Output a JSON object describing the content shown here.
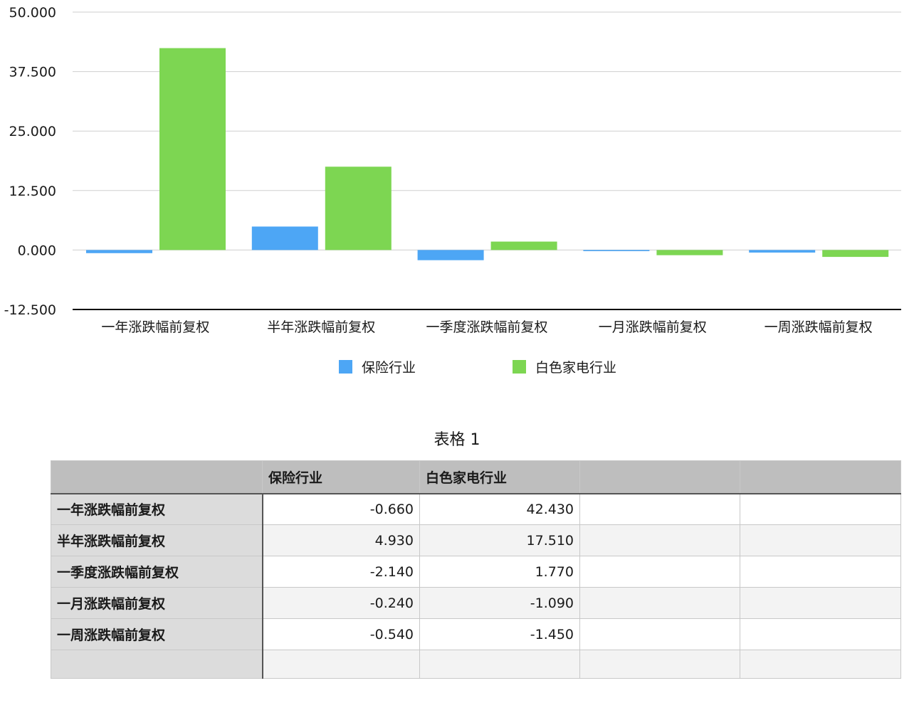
{
  "chart_data": {
    "type": "bar",
    "categories": [
      "一年涨跌幅前复权",
      "半年涨跌幅前复权",
      "一季度涨跌幅前复权",
      "一月涨跌幅前复权",
      "一周涨跌幅前复权"
    ],
    "series": [
      {
        "name": "保险行业",
        "values": [
          -0.66,
          4.93,
          -2.14,
          -0.24,
          -0.54
        ],
        "color": "#4da6f5"
      },
      {
        "name": "白色家电行业",
        "values": [
          42.43,
          17.51,
          1.77,
          -1.09,
          -1.45
        ],
        "color": "#7dd652"
      }
    ],
    "ylim": [
      -12.5,
      50
    ],
    "yticks": [
      "50.000",
      "37.500",
      "25.000",
      "12.500",
      "0.000",
      "-12.500"
    ],
    "grid": true,
    "legend": "bottom",
    "title": "",
    "xlabel": "",
    "ylabel": ""
  },
  "table": {
    "title": "表格 1",
    "headers": [
      "",
      "保险行业",
      "白色家电行业",
      "",
      ""
    ],
    "rows": [
      {
        "label": "一年涨跌幅前复权",
        "values": [
          "-0.660",
          "42.430",
          "",
          ""
        ]
      },
      {
        "label": "半年涨跌幅前复权",
        "values": [
          "4.930",
          "17.510",
          "",
          ""
        ]
      },
      {
        "label": "一季度涨跌幅前复权",
        "values": [
          "-2.140",
          "1.770",
          "",
          ""
        ]
      },
      {
        "label": "一月涨跌幅前复权",
        "values": [
          "-0.240",
          "-1.090",
          "",
          ""
        ]
      },
      {
        "label": "一周涨跌幅前复权",
        "values": [
          "-0.540",
          "-1.450",
          "",
          ""
        ]
      },
      {
        "label": "",
        "values": [
          "",
          "",
          "",
          ""
        ]
      }
    ]
  }
}
